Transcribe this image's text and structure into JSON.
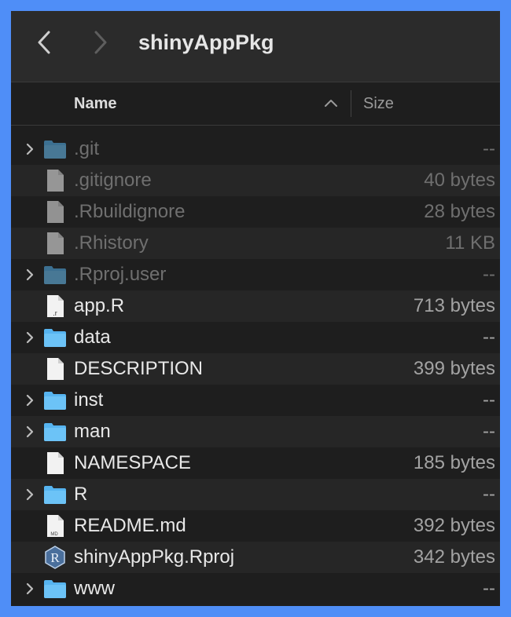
{
  "window": {
    "title": "shinyAppPkg"
  },
  "columns": {
    "name_label": "Name",
    "size_label": "Size"
  },
  "colors": {
    "folder": "#56b4f0",
    "background": "#1e1e1e",
    "accent": "#4f8ef7"
  },
  "files": [
    {
      "name": ".git",
      "size": "--",
      "kind": "folder",
      "hidden": true
    },
    {
      "name": ".gitignore",
      "size": "40 bytes",
      "kind": "doc",
      "hidden": true
    },
    {
      "name": ".Rbuildignore",
      "size": "28 bytes",
      "kind": "doc",
      "hidden": true
    },
    {
      "name": ".Rhistory",
      "size": "11 KB",
      "kind": "doc",
      "hidden": true
    },
    {
      "name": ".Rproj.user",
      "size": "--",
      "kind": "folder",
      "hidden": true
    },
    {
      "name": "app.R",
      "size": "713 bytes",
      "kind": "r-script",
      "badge": ".r",
      "hidden": false
    },
    {
      "name": "data",
      "size": "--",
      "kind": "folder",
      "hidden": false
    },
    {
      "name": "DESCRIPTION",
      "size": "399 bytes",
      "kind": "doc",
      "hidden": false
    },
    {
      "name": "inst",
      "size": "--",
      "kind": "folder",
      "hidden": false
    },
    {
      "name": "man",
      "size": "--",
      "kind": "folder",
      "hidden": false
    },
    {
      "name": "NAMESPACE",
      "size": "185 bytes",
      "kind": "doc",
      "hidden": false
    },
    {
      "name": "R",
      "size": "--",
      "kind": "folder",
      "hidden": false
    },
    {
      "name": "README.md",
      "size": "392 bytes",
      "kind": "markdown",
      "badge": "MD",
      "hidden": false
    },
    {
      "name": "shinyAppPkg.Rproj",
      "size": "342 bytes",
      "kind": "rproj",
      "badge": "R",
      "hidden": false
    },
    {
      "name": "www",
      "size": "--",
      "kind": "folder",
      "hidden": false
    }
  ]
}
